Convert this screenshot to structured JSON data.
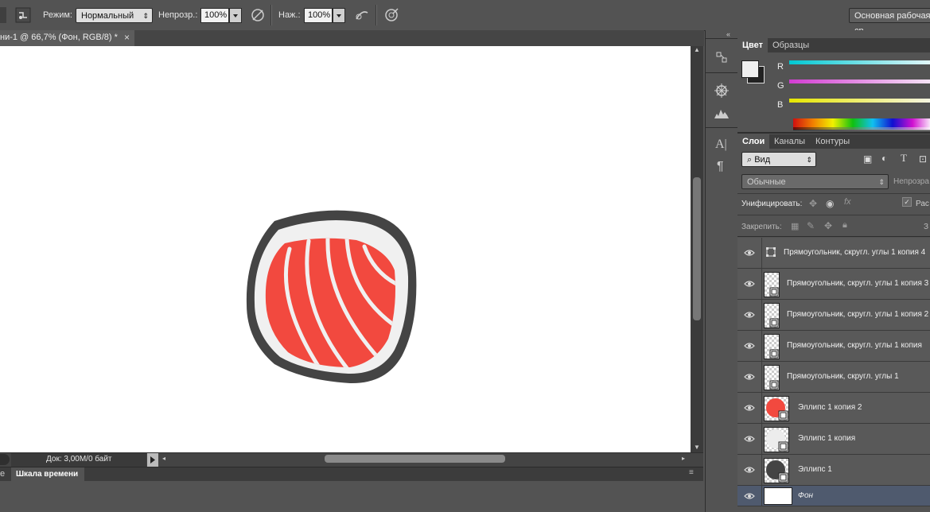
{
  "options_bar": {
    "mode_label": "Режим:",
    "mode_value": "Нормальный",
    "opacity_label": "Непрозр.:",
    "opacity_value": "100%",
    "pressure_label": "Наж.:",
    "pressure_value": "100%",
    "workspace_button": "Основная рабочая ср"
  },
  "document": {
    "tab_title": "ни-1 @ 66,7% (Фон, RGB/8) *",
    "close_glyph": "×",
    "status_text": "Док: 3,00M/0 байт"
  },
  "timeline": {
    "partial_tab": "е",
    "tab_label": "Шкала времени"
  },
  "color_panel": {
    "tabs": [
      "Цвет",
      "Образцы"
    ],
    "channels": [
      "R",
      "G",
      "B"
    ],
    "colors": {
      "r": "#00c8d2",
      "g": "#d23cd2",
      "b": "#e6e600"
    }
  },
  "layers_panel": {
    "tabs": [
      "Слои",
      "Каналы",
      "Контуры"
    ],
    "filter_value": "Вид",
    "blend_value": "Обычные",
    "opacity_label": "Непрозра",
    "unify_label": "Унифицировать:",
    "propagate_label": "Рас",
    "lock_label": "Закрепить:",
    "fill_label": "З",
    "layers": [
      {
        "name": "Прямоугольник, скругл. углы 1 копия 4",
        "thumb": "shape-icon",
        "selected": false
      },
      {
        "name": "Прямоугольник, скругл. углы 1 копия 3",
        "thumb": "transparent",
        "selected": false
      },
      {
        "name": "Прямоугольник, скругл. углы 1 копия 2",
        "thumb": "transparent",
        "selected": false
      },
      {
        "name": "Прямоугольник, скругл. углы 1 копия",
        "thumb": "transparent",
        "selected": false
      },
      {
        "name": "Прямоугольник, скругл. углы 1",
        "thumb": "transparent",
        "selected": false
      },
      {
        "name": "Эллипс 1 копия 2",
        "thumb": "red-ellipse",
        "selected": false
      },
      {
        "name": "Эллипс 1 копия",
        "thumb": "light-ellipse",
        "selected": false
      },
      {
        "name": "Эллипс 1",
        "thumb": "dark-ellipse",
        "selected": false
      },
      {
        "name": "Фон",
        "thumb": "white",
        "selected": true
      }
    ]
  },
  "artwork_colors": {
    "outline": "#444444",
    "rice": "#f0f0f0",
    "salmon": "#f2493f"
  }
}
